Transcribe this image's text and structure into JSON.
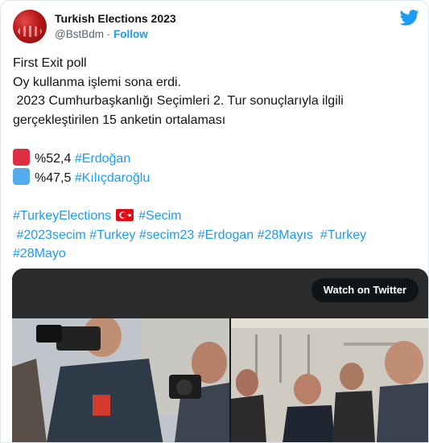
{
  "account": {
    "name": "Turkish Elections 2023",
    "handle": "@BstBdm",
    "separator": "·",
    "follow_label": "Follow"
  },
  "tweet": {
    "line1": "First Exit poll",
    "line2": "Oy kullanma işlemi sona erdi.",
    "line3": " 2023 Cumhurbaşkanlığı Seçimleri 2. Tur sonuçlarıyla ilgili",
    "line4": "gerçekleştirilen 15 anketin ortalaması",
    "result1_value": "%52,4",
    "result1_tag": "#Erdoğan",
    "result2_value": "%47,5",
    "result2_tag": "#Kılıçdaroğlu",
    "tags_row1_a": "#TurkeyElections",
    "tags_row1_b": "#Secim",
    "tags_row2": [
      " #2023secim",
      "#Turkey",
      "#secim23",
      "#Erdogan",
      "#28Mayıs",
      " #Turkey"
    ],
    "tags_row3": "#28Mayo"
  },
  "media": {
    "watch_label": "Watch on Twitter"
  },
  "colors": {
    "accent": "#1d9bf0",
    "erdogan_square": "#dd2e44",
    "kilicdaroglu_square": "#55acee"
  },
  "icons": [
    "twitter-bird-icon",
    "red-square-icon",
    "blue-square-icon",
    "turkey-flag-icon"
  ]
}
